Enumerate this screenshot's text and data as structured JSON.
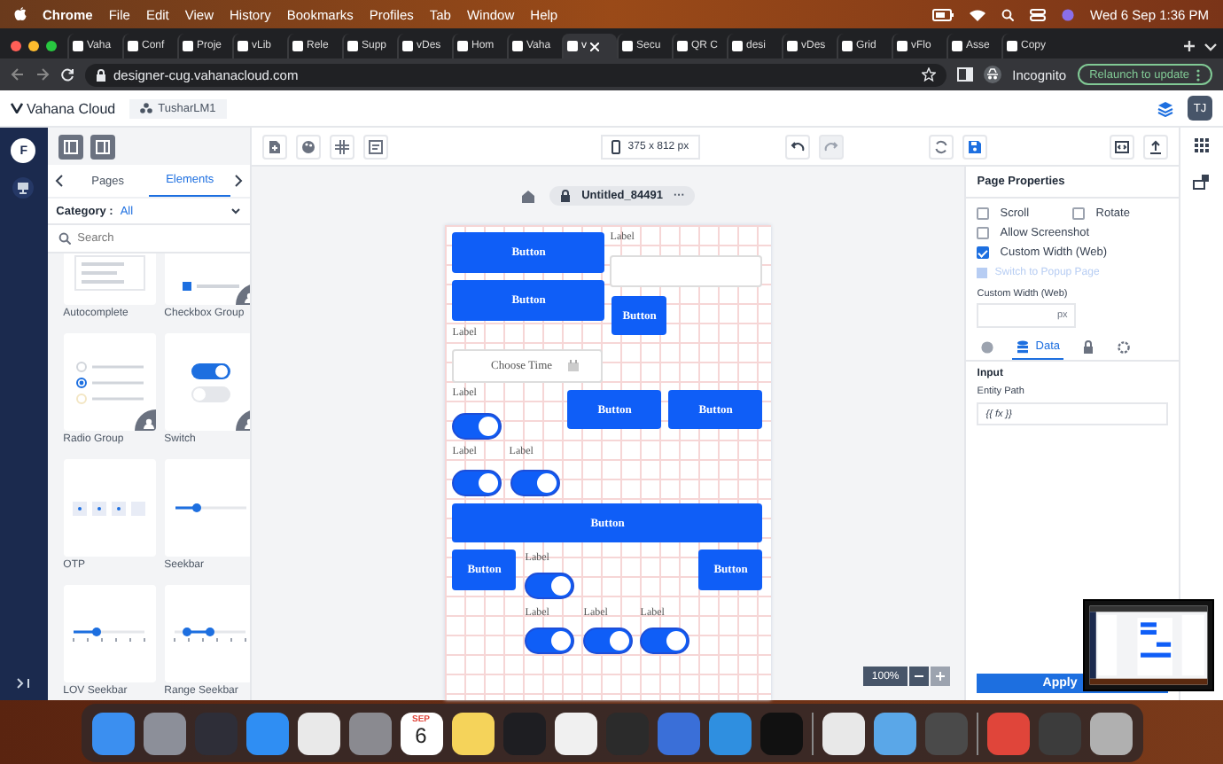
{
  "menu_bar": {
    "app": "Chrome",
    "items": [
      "File",
      "Edit",
      "View",
      "History",
      "Bookmarks",
      "Profiles",
      "Tab",
      "Window",
      "Help"
    ],
    "clock": "Wed 6 Sep  1:36 PM"
  },
  "browser": {
    "tabs": [
      {
        "title": "Vaha",
        "selected": false
      },
      {
        "title": "Conf",
        "selected": false
      },
      {
        "title": "Proje",
        "selected": false
      },
      {
        "title": "vLib",
        "selected": false
      },
      {
        "title": "Rele",
        "selected": false
      },
      {
        "title": "Supp",
        "selected": false
      },
      {
        "title": "vDes",
        "selected": false
      },
      {
        "title": "Hom",
        "selected": false
      },
      {
        "title": "Vaha",
        "selected": false
      },
      {
        "title": "v",
        "selected": true
      },
      {
        "title": "Secu",
        "selected": false
      },
      {
        "title": "QR C",
        "selected": false
      },
      {
        "title": "desi",
        "selected": false
      },
      {
        "title": "vDes",
        "selected": false
      },
      {
        "title": "Grid",
        "selected": false
      },
      {
        "title": "vFlo",
        "selected": false
      },
      {
        "title": "Asse",
        "selected": false
      },
      {
        "title": "Copy",
        "selected": false
      }
    ],
    "url": "designer-cug.vahanacloud.com",
    "profile": "Incognito",
    "update_button": "Relaunch to update"
  },
  "app_header": {
    "brand": "Vahana Cloud",
    "workspace": "TusharLM1",
    "avatar": "TJ"
  },
  "left_rail": {
    "avatar": "F"
  },
  "elements_panel": {
    "tabs": [
      {
        "label": "Pages",
        "selected": false
      },
      {
        "label": "Elements",
        "selected": true
      }
    ],
    "category_label": "Category :",
    "category_value": "All",
    "search": {
      "placeholder": "Search"
    },
    "cards": [
      {
        "kind": "autocomplete",
        "label": "Autocomplete",
        "corner_badge": false
      },
      {
        "kind": "checkbox_group",
        "label": "Checkbox Group",
        "corner_badge": true
      },
      {
        "kind": "radio_group",
        "label": "Radio Group",
        "corner_badge": true
      },
      {
        "kind": "switch",
        "label": "Switch",
        "corner_badge": true
      },
      {
        "kind": "otp",
        "label": "OTP",
        "corner_badge": false
      },
      {
        "kind": "seekbar",
        "label": "Seekbar",
        "corner_badge": false
      },
      {
        "kind": "lov_seekbar",
        "label": "LOV Seekbar",
        "corner_badge": false
      },
      {
        "kind": "range_seekbar",
        "label": "Range Seekbar",
        "corner_badge": false
      }
    ]
  },
  "toolbar": {
    "device": "375 x 812 px",
    "undo_disabled": false,
    "redo_disabled": true
  },
  "canvas": {
    "page_name": "Untitled_84491",
    "more": "···",
    "items": [
      {
        "kind": "button",
        "text": "Button"
      },
      {
        "kind": "label",
        "text": "Label"
      },
      {
        "kind": "input"
      },
      {
        "kind": "button",
        "text": "Button"
      },
      {
        "kind": "button",
        "text": "Button"
      },
      {
        "kind": "label",
        "text": "Label"
      },
      {
        "kind": "time_field",
        "placeholder": "Choose Time"
      },
      {
        "kind": "label",
        "text": "Label"
      },
      {
        "kind": "switch",
        "on": true
      },
      {
        "kind": "button",
        "text": "Button"
      },
      {
        "kind": "button",
        "text": "Button"
      },
      {
        "kind": "label",
        "text": "Label"
      },
      {
        "kind": "label",
        "text": "Label"
      },
      {
        "kind": "switch",
        "on": true
      },
      {
        "kind": "switch",
        "on": true
      },
      {
        "kind": "button",
        "text": "Button"
      },
      {
        "kind": "button",
        "text": "Button"
      },
      {
        "kind": "label",
        "text": "Label"
      },
      {
        "kind": "switch",
        "on": true
      },
      {
        "kind": "button",
        "text": "Button"
      },
      {
        "kind": "label",
        "text": "Label"
      },
      {
        "kind": "label",
        "text": "Label"
      },
      {
        "kind": "label",
        "text": "Label"
      },
      {
        "kind": "switch",
        "on": true
      },
      {
        "kind": "switch",
        "on": true
      },
      {
        "kind": "switch",
        "on": true
      }
    ],
    "zoom": "100%",
    "zoom_in_disabled": true
  },
  "page_properties": {
    "title": "Page Properties",
    "options": [
      {
        "label": "Scroll",
        "checked": false
      },
      {
        "label": "Rotate",
        "checked": false
      },
      {
        "label": "Allow Screenshot",
        "checked": false
      },
      {
        "label": "Custom Width (Web)",
        "checked": true
      }
    ],
    "popup_link": {
      "label": "Switch to Popup Page",
      "disabled": true
    },
    "width_label": "Custom Width (Web)",
    "width_unit": "px",
    "tabs": [
      {
        "kind": "palette",
        "selected": false
      },
      {
        "kind": "data",
        "label": "Data",
        "selected": true
      },
      {
        "kind": "lock",
        "selected": false
      },
      {
        "kind": "settings",
        "selected": false
      }
    ],
    "section": "Input",
    "entity_label": "Entity Path",
    "entity_value": "{{ fx }}",
    "apply": "Apply"
  },
  "dock": [
    {
      "kind": "app",
      "color": "#3b8ff0"
    },
    {
      "kind": "app",
      "color": "#8c8f99"
    },
    {
      "kind": "app",
      "color": "#2e2e38"
    },
    {
      "kind": "app",
      "color": "#2f8ef3"
    },
    {
      "kind": "app",
      "color": "#e9e9e9"
    },
    {
      "kind": "app",
      "color": "#8a8a90"
    },
    {
      "kind": "calendar",
      "month": "SEP",
      "day": "6"
    },
    {
      "kind": "app",
      "color": "#f5d35a"
    },
    {
      "kind": "app",
      "color": "#1e1e22"
    },
    {
      "kind": "app",
      "color": "#f0f0f0"
    },
    {
      "kind": "app",
      "color": "#2b2b2b"
    },
    {
      "kind": "app",
      "color": "#3a6fd8"
    },
    {
      "kind": "app",
      "color": "#2f8fe0"
    },
    {
      "kind": "app",
      "color": "#111111"
    },
    {
      "kind": "separator"
    },
    {
      "kind": "app",
      "color": "#e8e8e8"
    },
    {
      "kind": "app",
      "color": "#5aa7e8"
    },
    {
      "kind": "app",
      "color": "#4a4a4a"
    },
    {
      "kind": "separator"
    },
    {
      "kind": "app",
      "color": "#e0453a"
    },
    {
      "kind": "app",
      "color": "#3c3c3c"
    },
    {
      "kind": "app",
      "color": "#b0b0b0"
    }
  ]
}
